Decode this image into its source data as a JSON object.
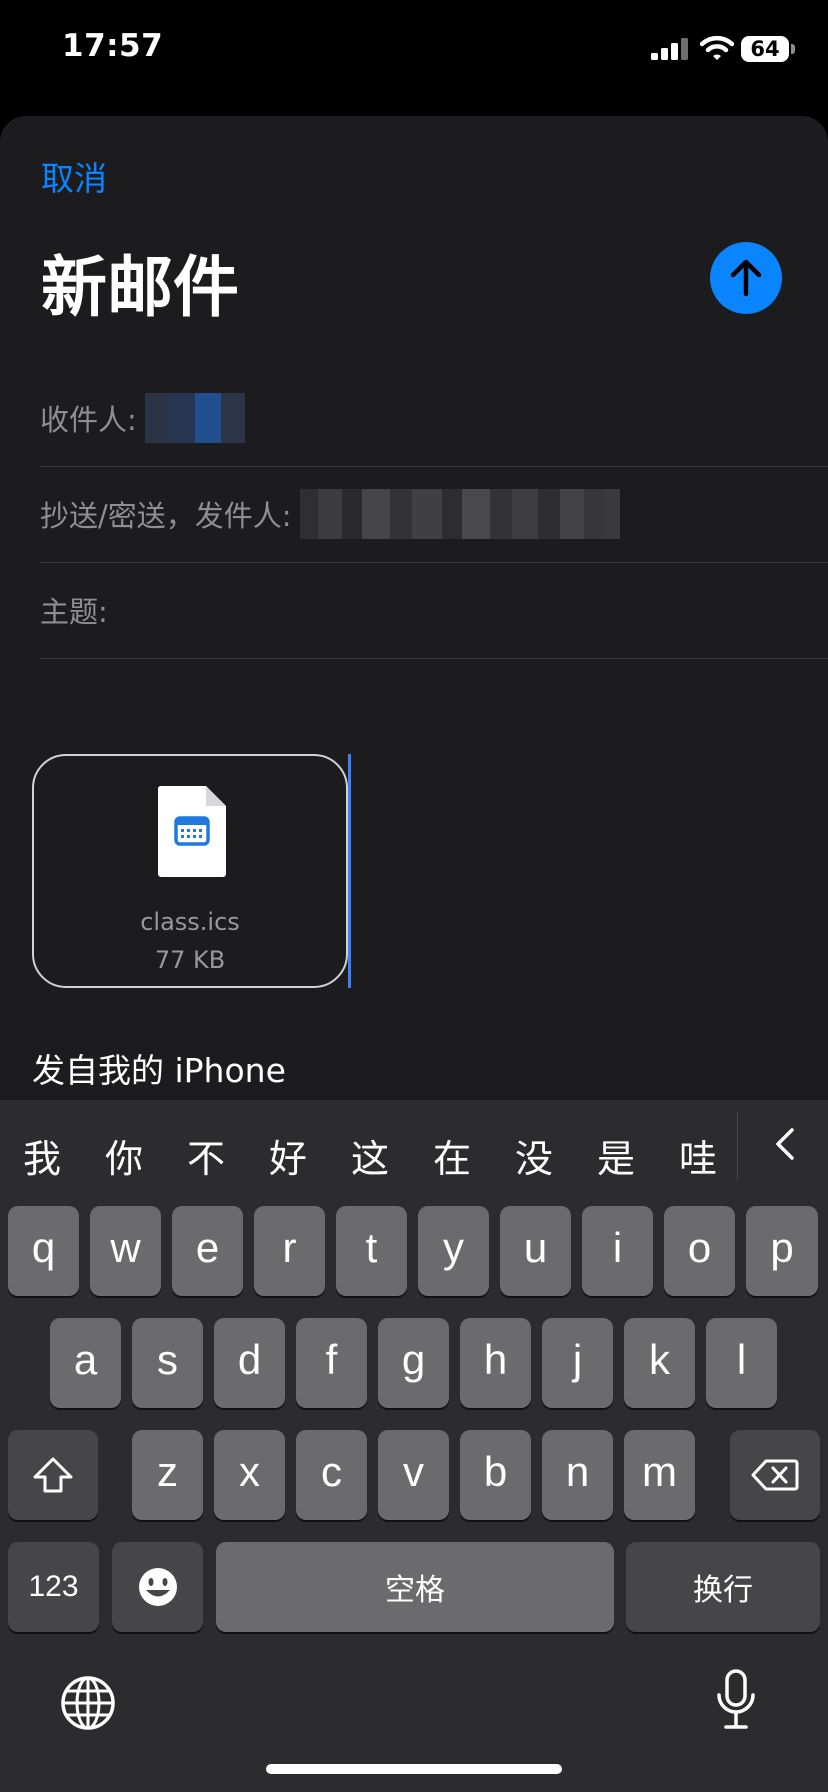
{
  "status_bar": {
    "time": "17:57",
    "battery": "64"
  },
  "compose": {
    "cancel_label": "取消",
    "title": "新邮件",
    "to_label": "收件人:",
    "cc_label": "抄送/密送，发件人:",
    "subject_label": "主题:",
    "attachment": {
      "name": "class.ics",
      "size": "77 KB"
    },
    "signature": "发自我的 iPhone"
  },
  "keyboard": {
    "candidates": [
      "我",
      "你",
      "不",
      "好",
      "这",
      "在",
      "没",
      "是",
      "哇"
    ],
    "row1": [
      "q",
      "w",
      "e",
      "r",
      "t",
      "y",
      "u",
      "i",
      "o",
      "p"
    ],
    "row2": [
      "a",
      "s",
      "d",
      "f",
      "g",
      "h",
      "j",
      "k",
      "l"
    ],
    "row3": [
      "z",
      "x",
      "c",
      "v",
      "b",
      "n",
      "m"
    ],
    "numbers_label": "123",
    "space_label": "空格",
    "return_label": "换行"
  },
  "colors": {
    "accent": "#0a84ff",
    "sheet": "#1c1c1e",
    "keyboard": "#2c2c2e"
  }
}
